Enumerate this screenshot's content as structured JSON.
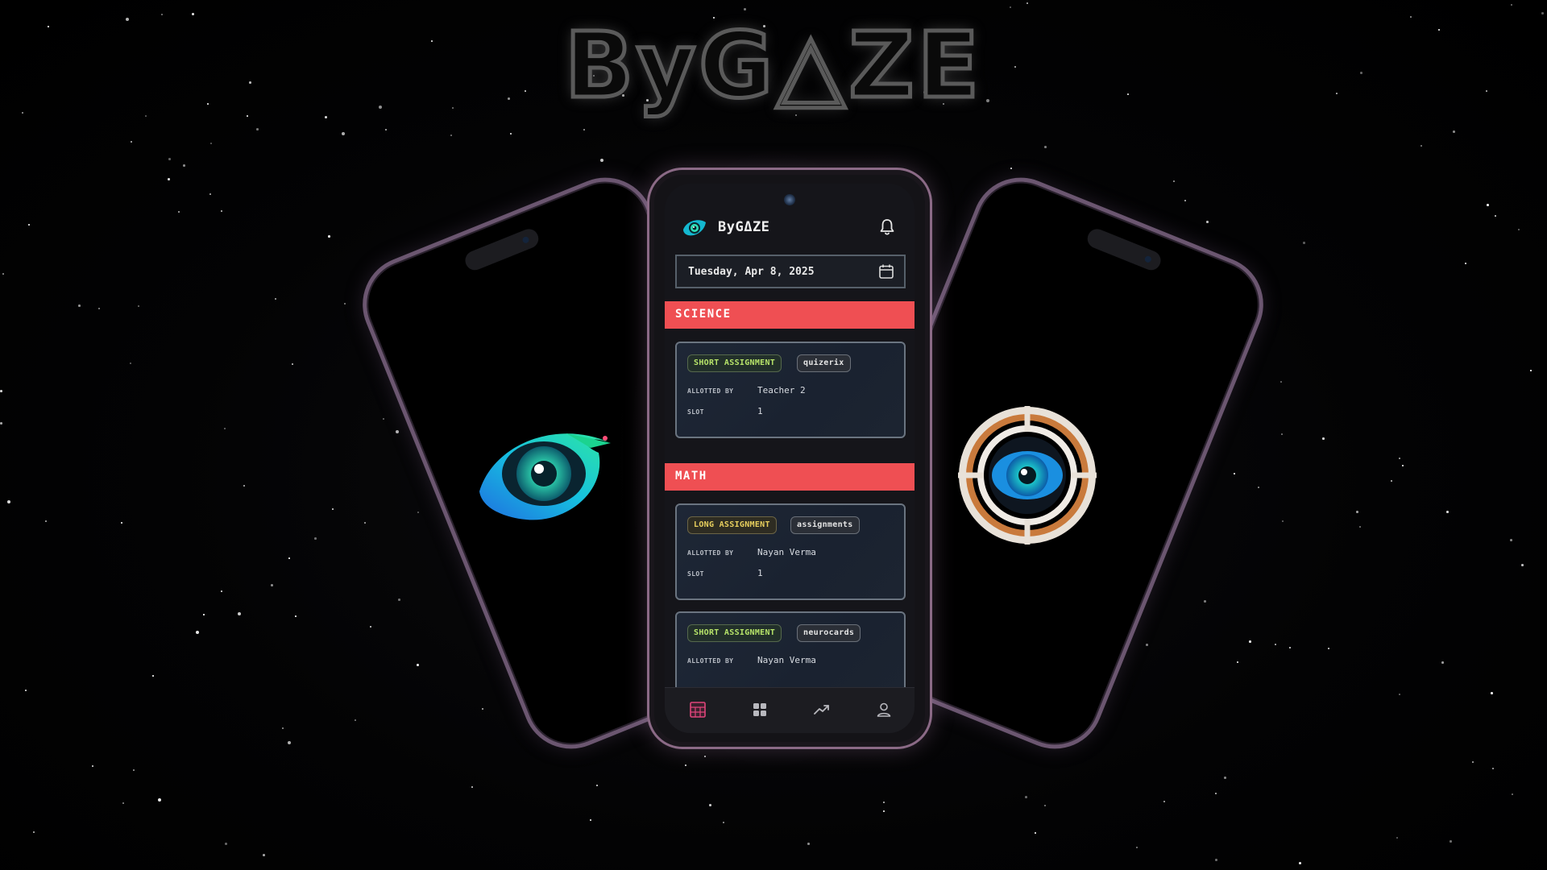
{
  "brand": {
    "wordmark": "ByG△ZE"
  },
  "app": {
    "name": "ByGΔZE",
    "date_value": "Tuesday, Apr 8, 2025"
  },
  "sections": [
    {
      "label": "SCIENCE",
      "cards": [
        {
          "type_tag": "SHORT ASSIGNMENT",
          "source_tag": "quizerix",
          "allotted_by_label": "ALLOTTED BY",
          "allotted_by": "Teacher 2",
          "slot_label": "SLOT",
          "slot": "1"
        }
      ]
    },
    {
      "label": "MATH",
      "cards": [
        {
          "type_tag": "LONG ASSIGNMENT",
          "source_tag": "assignments",
          "allotted_by_label": "ALLOTTED BY",
          "allotted_by": "Nayan Verma",
          "slot_label": "SLOT",
          "slot": "1"
        },
        {
          "type_tag": "SHORT ASSIGNMENT",
          "source_tag": "neurocards",
          "allotted_by_label": "ALLOTTED BY",
          "allotted_by": "Nayan Verma"
        }
      ]
    }
  ],
  "nav": {
    "items": [
      "schedule-icon",
      "grid-icon",
      "trending-icon",
      "user-icon"
    ],
    "active": 0
  },
  "colors": {
    "accent_red": "#ef4f53",
    "tag_short": "#b7e46a",
    "tag_long": "#e8cf5d",
    "active_nav": "#e0457b"
  }
}
